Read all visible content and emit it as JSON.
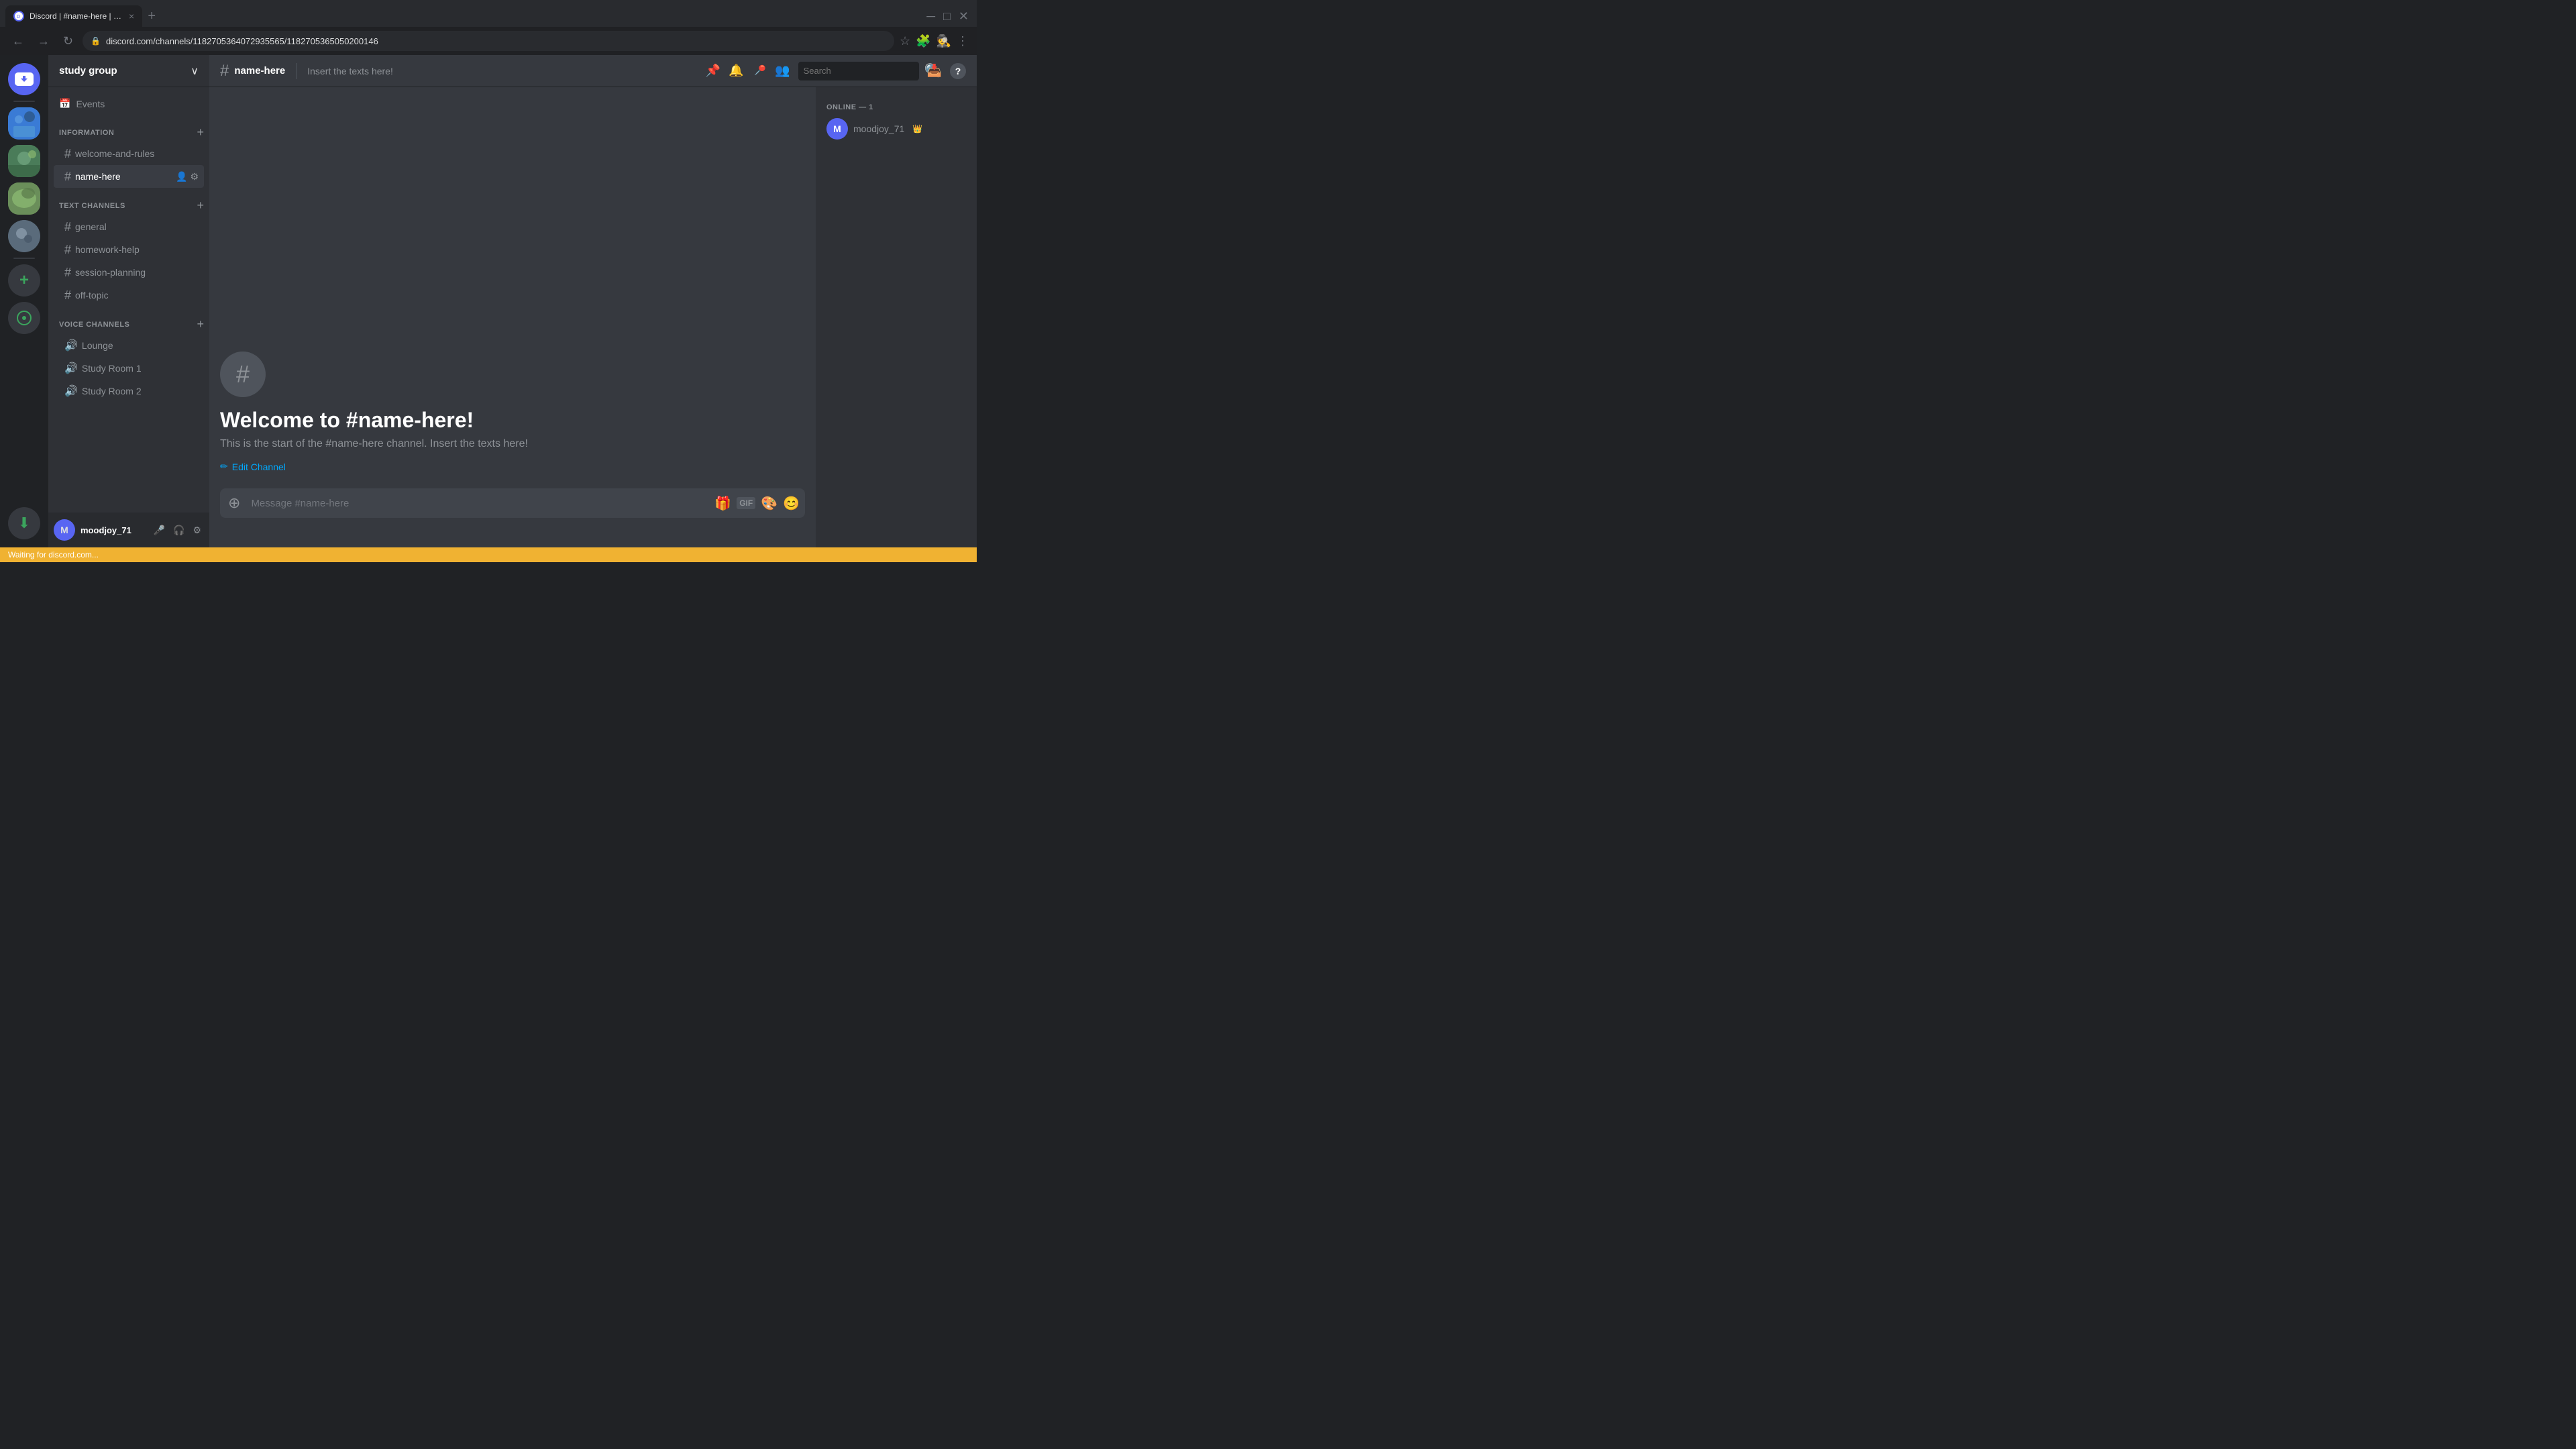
{
  "browser": {
    "tab_title": "Discord | #name-here | study gr...",
    "favicon_text": "D",
    "url": "discord.com/channels/1182705364072935565/1182705365050200146",
    "tab_close": "×",
    "new_tab": "+",
    "nav_back": "←",
    "nav_forward": "→",
    "nav_refresh": "↻"
  },
  "server_sidebar": {
    "servers": [
      {
        "id": "discord-home",
        "label": "Discord Home"
      },
      {
        "id": "server-1",
        "label": "Server 1"
      },
      {
        "id": "server-2",
        "label": "Server 2"
      },
      {
        "id": "server-3",
        "label": "Server 3"
      },
      {
        "id": "server-4",
        "label": "Server 4"
      }
    ],
    "add_server_label": "+",
    "discovery_label": "⊕",
    "download_label": "⬇"
  },
  "channel_sidebar": {
    "server_name": "study group",
    "events_label": "Events",
    "categories": [
      {
        "name": "INFORMATION",
        "channels": [
          {
            "name": "welcome-and-rules",
            "type": "text"
          },
          {
            "name": "name-here",
            "type": "text",
            "active": true
          }
        ]
      },
      {
        "name": "TEXT CHANNELS",
        "channels": [
          {
            "name": "general",
            "type": "text"
          },
          {
            "name": "homework-help",
            "type": "text"
          },
          {
            "name": "session-planning",
            "type": "text"
          },
          {
            "name": "off-topic",
            "type": "text"
          }
        ]
      },
      {
        "name": "VOICE CHANNELS",
        "channels": [
          {
            "name": "Lounge",
            "type": "voice"
          },
          {
            "name": "Study Room 1",
            "type": "voice"
          },
          {
            "name": "Study Room 2",
            "type": "voice"
          }
        ]
      }
    ]
  },
  "user_panel": {
    "username": "moodjoy_71",
    "tag": "",
    "avatar_initial": "M",
    "mute_icon": "🎤",
    "deafen_icon": "🎧",
    "settings_icon": "⚙"
  },
  "topbar": {
    "channel_name": "name-here",
    "description": "Insert the texts here!",
    "actions": {
      "pin": "📌",
      "bell": "🔔",
      "bookmark": "📌",
      "members": "👥",
      "search_placeholder": "Search",
      "inbox": "📥",
      "help": "?"
    }
  },
  "welcome": {
    "icon": "#",
    "title": "Welcome to #name-here!",
    "description": "This is the start of the #name-here channel. Insert the texts here!",
    "edit_channel_label": "Edit Channel"
  },
  "members_sidebar": {
    "online_count": "ONLINE — 1",
    "members": [
      {
        "name": "moodjoy_71",
        "crown": true,
        "avatar_initial": "M"
      }
    ]
  },
  "message_input": {
    "placeholder": "Message #name-here",
    "add_icon": "+",
    "gift_icon": "🎁",
    "gif_label": "GIF",
    "sticker_icon": "🎨",
    "emoji_icon": "😊"
  },
  "status_bar": {
    "text": "Waiting for discord.com..."
  }
}
